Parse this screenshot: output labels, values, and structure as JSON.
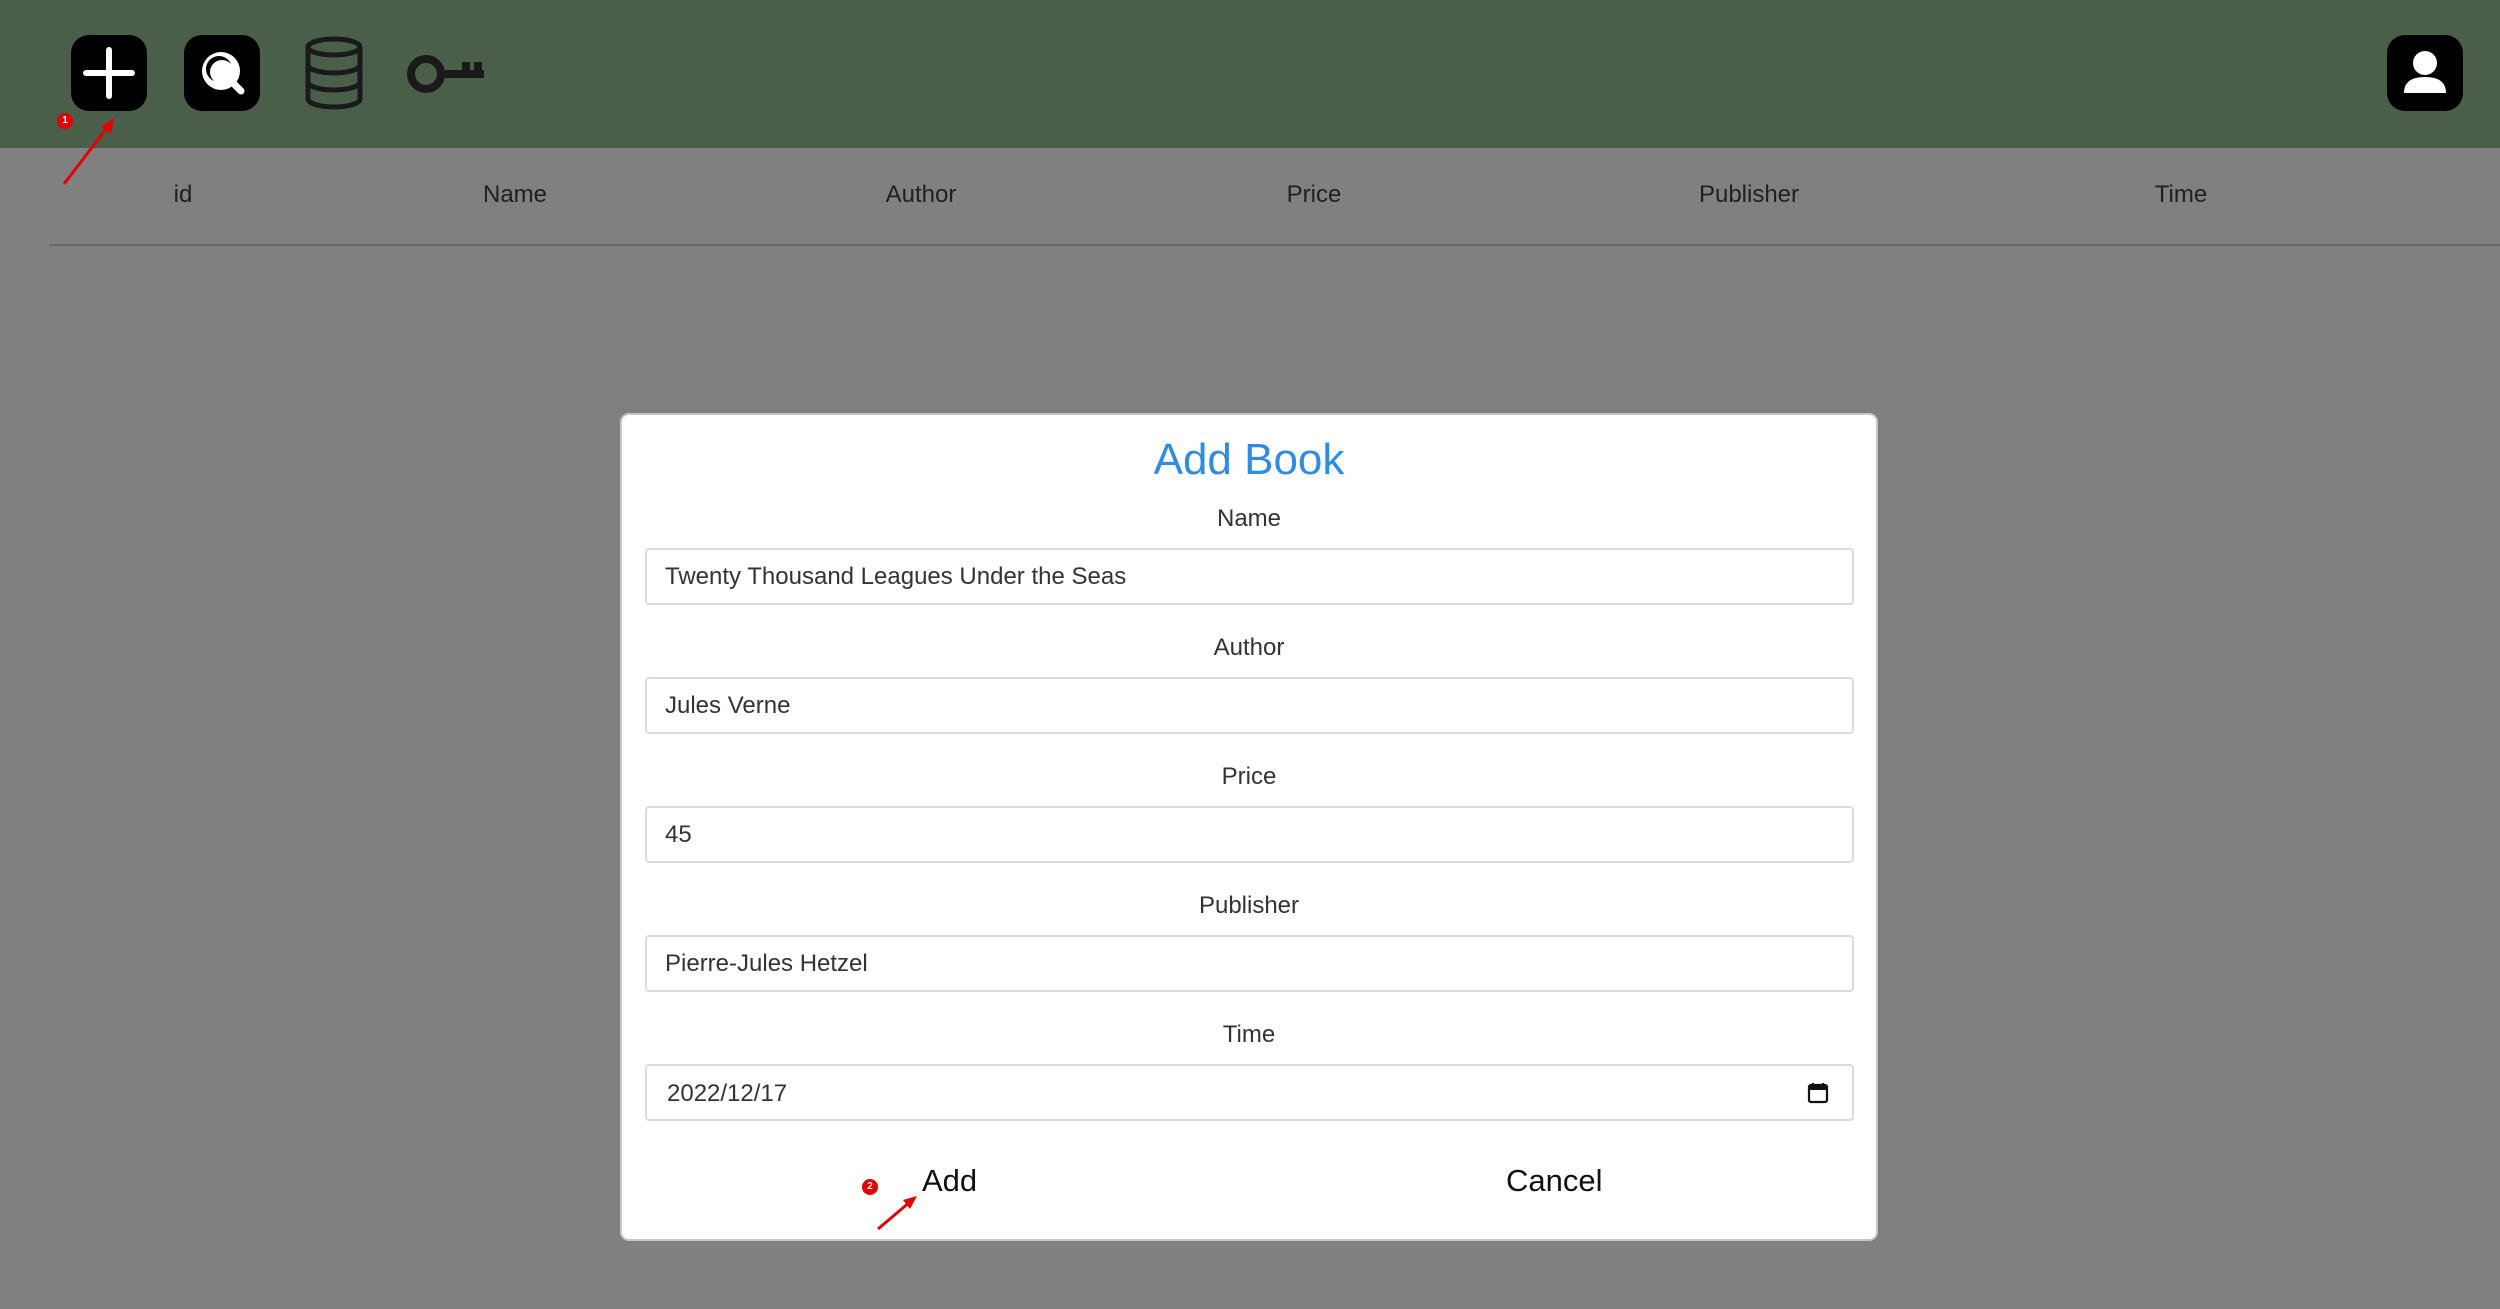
{
  "toolbar": {
    "icons": [
      "plus-icon",
      "search-icon",
      "database-icon",
      "key-icon",
      "user-icon"
    ],
    "background": "#4a5e4a"
  },
  "table": {
    "columns": [
      "id",
      "Name",
      "Author",
      "Price",
      "Publisher",
      "Time"
    ]
  },
  "modal": {
    "title": "Add Book",
    "title_color": "#2f8ce0",
    "fields": [
      {
        "label": "Name",
        "value": "Twenty Thousand Leagues Under the Seas"
      },
      {
        "label": "Author",
        "value": "Jules Verne"
      },
      {
        "label": "Price",
        "value": "45"
      },
      {
        "label": "Publisher",
        "value": "Pierre-Jules Hetzel"
      },
      {
        "label": "Time",
        "value": "2022/12/17"
      }
    ],
    "add_label": "Add",
    "cancel_label": "Cancel"
  },
  "annotations": {
    "badge_1": "1",
    "badge_2": "2",
    "color": "#e00000"
  }
}
